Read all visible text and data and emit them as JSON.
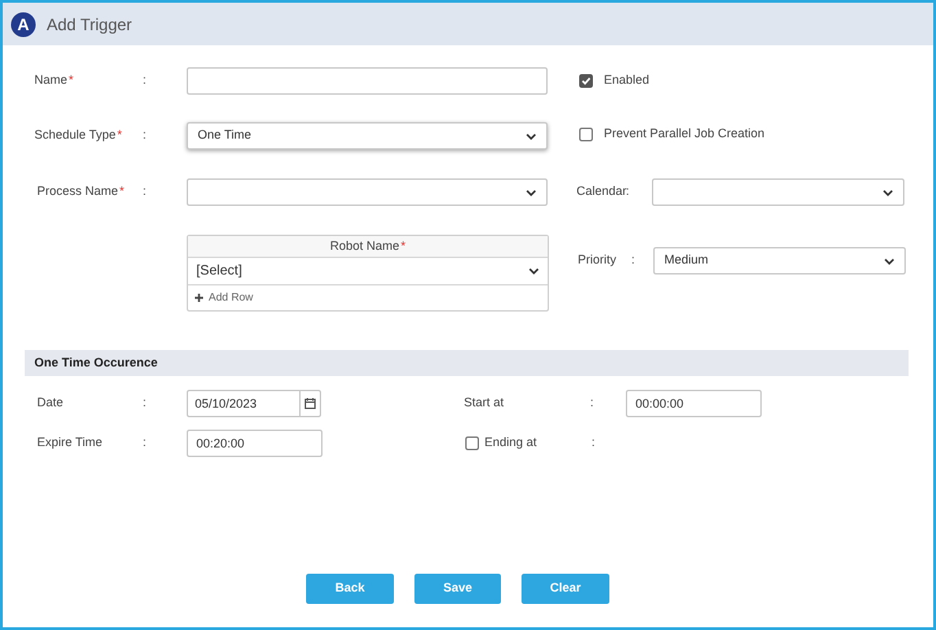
{
  "header": {
    "logo": "A",
    "title": "Add Trigger"
  },
  "name": {
    "label": "Name",
    "mark": "*",
    "separator": ":"
  },
  "enabled": {
    "label": "Enabled",
    "checked": true
  },
  "schedule_type": {
    "label": "Schedule Type",
    "mark": "*",
    "separator": ":",
    "value": "One Time"
  },
  "prevent_parallel": {
    "label": "Prevent Parallel Job Creation",
    "checked": false
  },
  "process_name": {
    "label": "Process Name",
    "mark": "*",
    "separator": ":"
  },
  "calendar": {
    "label": "Calendar",
    "separator": ":"
  },
  "robot_table": {
    "column": "Robot Name",
    "mark": "*",
    "rows": [
      {
        "value": "[Select]"
      }
    ],
    "add_row": "Add Row"
  },
  "priority": {
    "label": "Priority",
    "separator": ":",
    "value": "Medium"
  },
  "section": {
    "title": "One Time Occurence"
  },
  "date": {
    "label": "Date",
    "separator": ":",
    "value": "05/10/2023"
  },
  "start_at": {
    "label": "Start at",
    "separator": ":",
    "value": "00:00:00"
  },
  "expire_time": {
    "label": "Expire Time",
    "separator": ":",
    "value": "00:20:00"
  },
  "ending_at": {
    "label": "Ending at",
    "separator": ":",
    "checked": false
  },
  "buttons": [
    "Back",
    "Save",
    "Clear"
  ]
}
